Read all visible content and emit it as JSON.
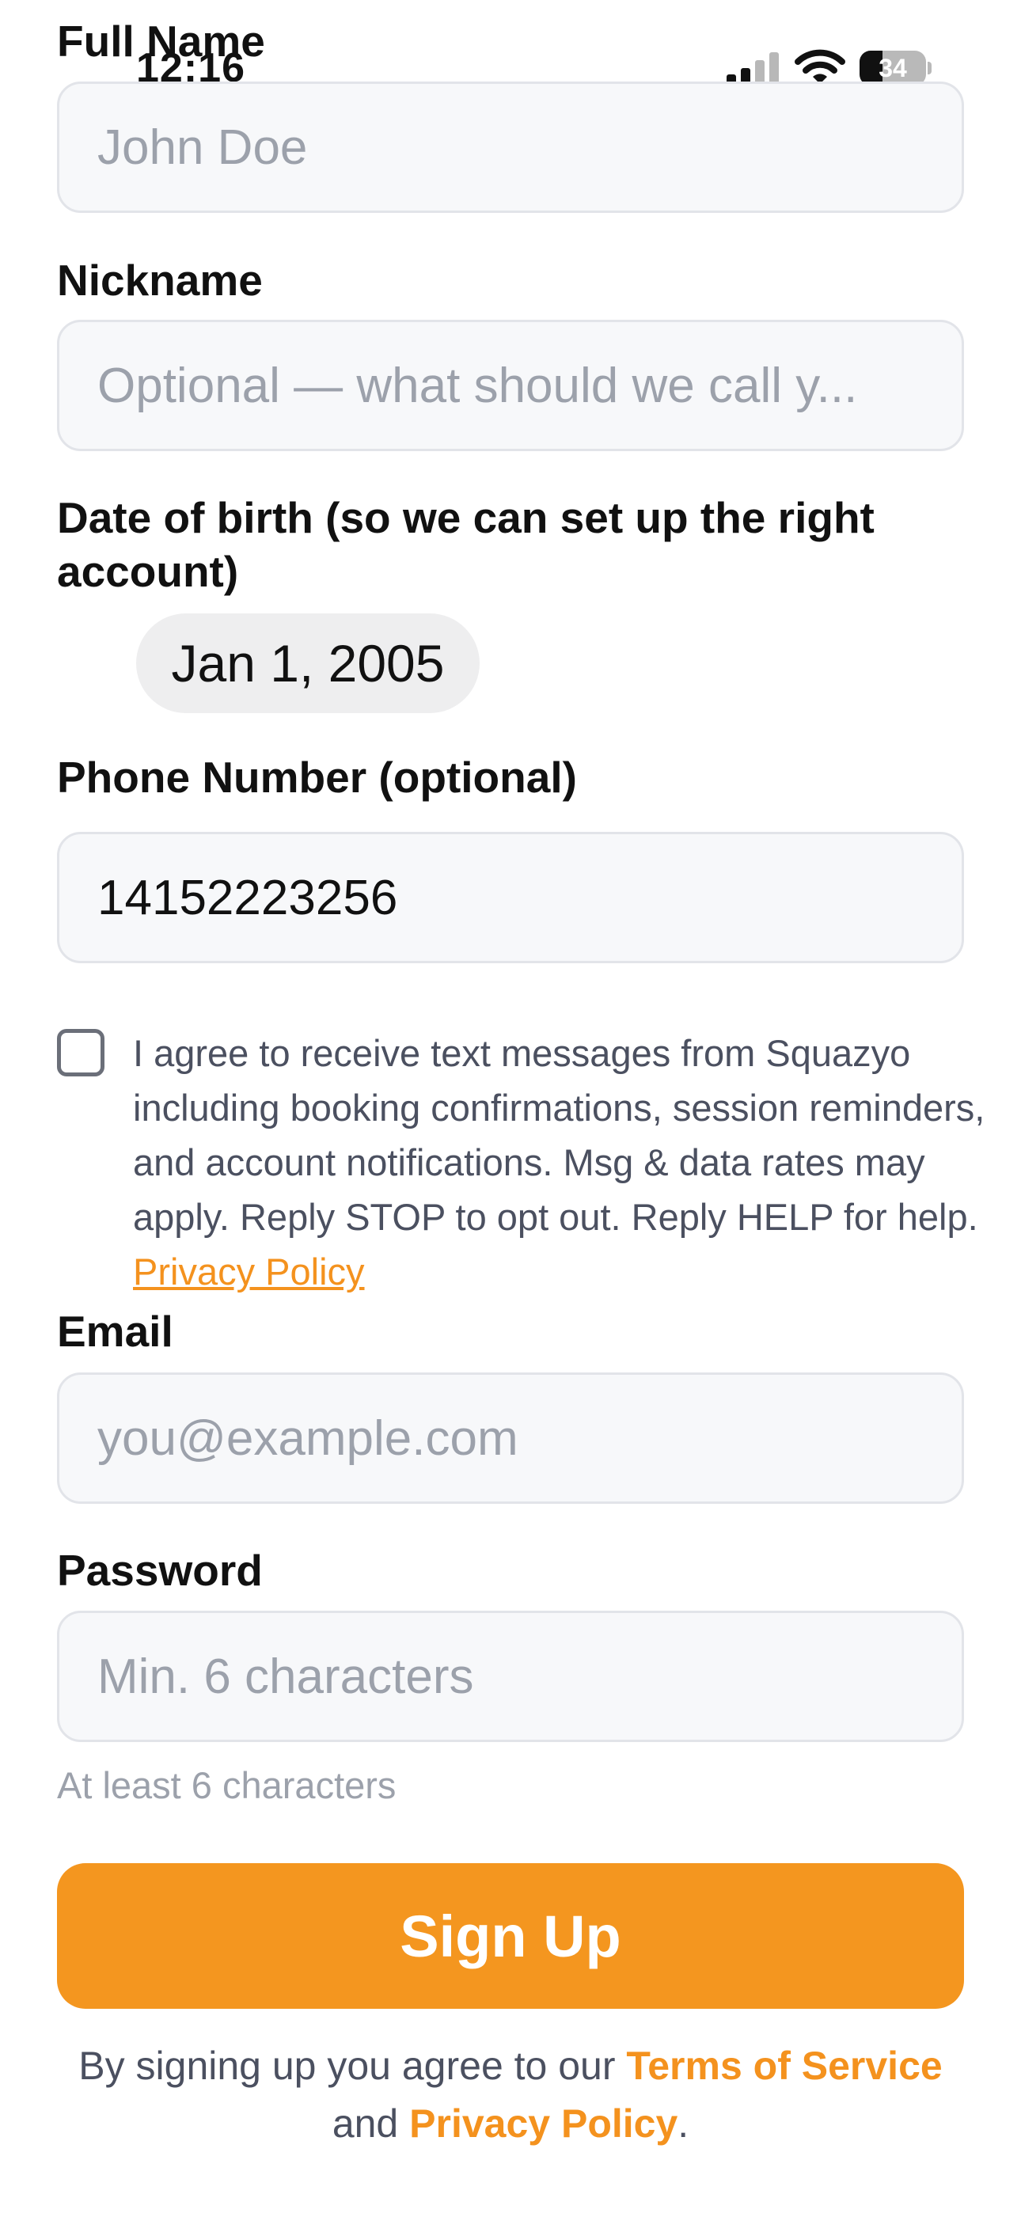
{
  "status_bar": {
    "time": "12:16",
    "battery": "34",
    "battery_level": 0.34
  },
  "form": {
    "full_name": {
      "label": "Full Name",
      "placeholder": "John Doe",
      "value": ""
    },
    "nickname": {
      "label": "Nickname",
      "placeholder": "Optional — what should we call y...",
      "value": ""
    },
    "dob": {
      "label": "Date of birth (so we can set up the right account)",
      "value": "Jan 1, 2005"
    },
    "phone": {
      "label": "Phone Number (optional)",
      "value": "14152223256"
    },
    "sms_consent": {
      "checked": false,
      "text": "I agree to receive text messages from Squazyo including booking confirmations, session reminders, and account notifications. Msg & data rates may apply. Reply STOP to opt out. Reply HELP for help.",
      "link": "Privacy Policy"
    },
    "email": {
      "label": "Email",
      "placeholder": "you@example.com",
      "value": ""
    },
    "password": {
      "label": "Password",
      "placeholder": "Min. 6 characters",
      "helper": "At least 6 characters"
    }
  },
  "signup_button": "Sign Up",
  "legal": {
    "prefix": "By signing up you agree to our",
    "terms": "Terms of Service",
    "and": "and",
    "privacy": "Privacy Policy",
    "suffix": "."
  },
  "colors": {
    "accent": "#f4961f",
    "input_bg": "#f7f8fa",
    "placeholder": "#9ca1ab"
  }
}
